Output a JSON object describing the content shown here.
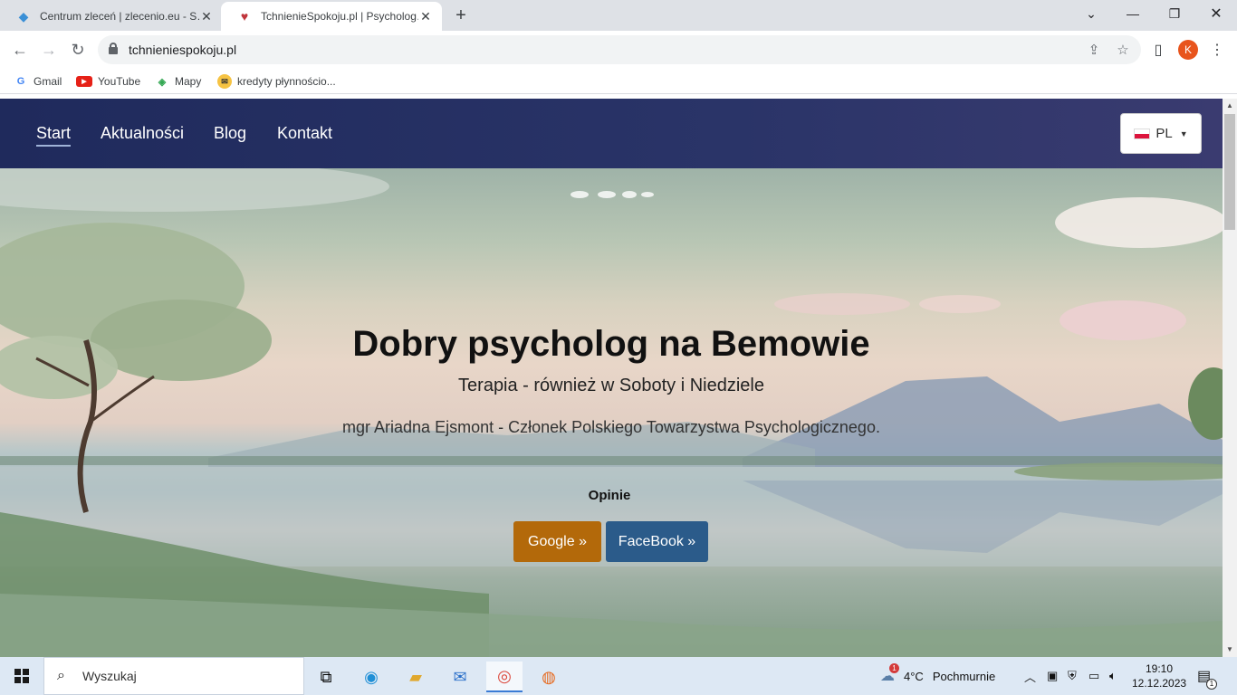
{
  "browser": {
    "tabs": [
      {
        "title": "Centrum zleceń | zlecenio.eu - S…",
        "favicon": "gem-icon",
        "active": false
      },
      {
        "title": "TchnienieSpokoju.pl | Psycholog…",
        "favicon": "heart-icon",
        "active": true
      }
    ],
    "url": "tchnieniespokoju.pl",
    "profile_initial": "K",
    "bookmarks": [
      {
        "label": "Gmail",
        "icon": "google-icon"
      },
      {
        "label": "YouTube",
        "icon": "youtube-icon"
      },
      {
        "label": "Mapy",
        "icon": "maps-icon"
      },
      {
        "label": "kredyty płynnościo...",
        "icon": "mail-icon"
      }
    ]
  },
  "site": {
    "nav": [
      {
        "label": "Start",
        "active": true
      },
      {
        "label": "Aktualności",
        "active": false
      },
      {
        "label": "Blog",
        "active": false
      },
      {
        "label": "Kontakt",
        "active": false
      }
    ],
    "language": {
      "code": "PL",
      "flag": "poland-flag-icon"
    },
    "hero": {
      "title": "Dobry psycholog na Bemowie",
      "subtitle": "Terapia - również w Soboty i Niedziele",
      "author": "mgr Ariadna Ejsmont - Członek Polskiego Towarzystwa Psychologicznego.",
      "reviews_label": "Opinie",
      "buttons": [
        {
          "label": "Google »",
          "color": "#b3690a"
        },
        {
          "label": "FaceBook »",
          "color": "#2b5b8a"
        }
      ]
    }
  },
  "taskbar": {
    "search_placeholder": "Wyszukaj",
    "weather": {
      "temp": "4°C",
      "condition": "Pochmurnie",
      "badge": "1"
    },
    "time": "19:10",
    "date": "12.12.2023",
    "notifications": "1"
  },
  "colors": {
    "nav_bg": "#1f2a5c",
    "google_btn": "#b3690a",
    "facebook_btn": "#2b5b8a"
  }
}
